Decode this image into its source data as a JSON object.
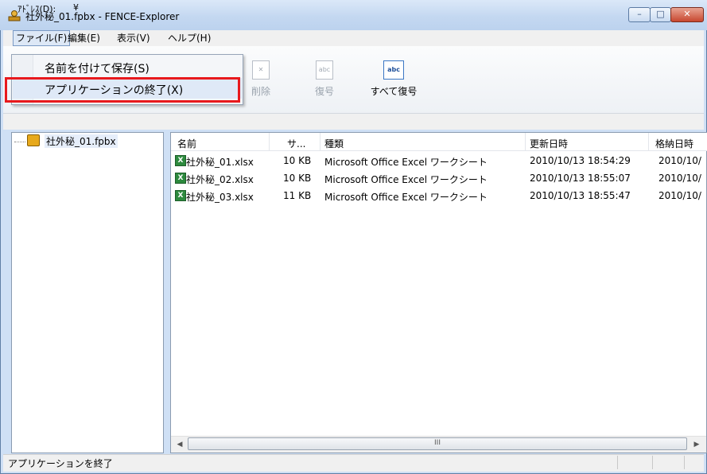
{
  "window": {
    "title": "社外秘_01.fpbx - FENCE-Explorer",
    "controls": {
      "minimize": "–",
      "maximize": "□",
      "close": "✕"
    }
  },
  "menubar": {
    "file": "ファイル(F)",
    "edit": "編集(E)",
    "view": "表示(V)",
    "help": "ヘルプ(H)"
  },
  "file_menu": {
    "items": [
      "名前を付けて保存(S)",
      "アプリケーションの終了(X)"
    ],
    "highlighted_item": "アプリケーションの終了(X)"
  },
  "toolbar": {
    "delete_label": "削除",
    "decrypt_label": "復号",
    "decrypt_all_label": "すべて復号",
    "delete_icon_text": "✕",
    "decrypt_icon_text": "abc",
    "decrypt_all_icon_text": "abc"
  },
  "address": {
    "label": "ｱﾄﾞﾚｽ(D):",
    "value": "¥"
  },
  "tree": {
    "root_label": "社外秘_01.fpbx"
  },
  "list": {
    "columns": [
      "名前",
      "サ...",
      "種類",
      "更新日時",
      "格納日時"
    ],
    "rows": [
      {
        "name": "社外秘_01.xlsx",
        "size": "10 KB",
        "type": "Microsoft Office Excel ワークシート",
        "modified": "2010/10/13 18:54:29",
        "stored": "2010/10/"
      },
      {
        "name": "社外秘_02.xlsx",
        "size": "10 KB",
        "type": "Microsoft Office Excel ワークシート",
        "modified": "2010/10/13 18:55:07",
        "stored": "2010/10/"
      },
      {
        "name": "社外秘_03.xlsx",
        "size": "11 KB",
        "type": "Microsoft Office Excel ワークシート",
        "modified": "2010/10/13 18:55:47",
        "stored": "2010/10/"
      }
    ],
    "file_icon_text": "X"
  },
  "scrollbar": {
    "left_arrow": "◀",
    "right_arrow": "▶",
    "grip": "III"
  },
  "status": {
    "text": "アプリケーションを終了"
  },
  "colors": {
    "highlight_border": "#e8191d",
    "title_bar": "#c4d8f1",
    "menu_hover": "#dfe9f7"
  }
}
